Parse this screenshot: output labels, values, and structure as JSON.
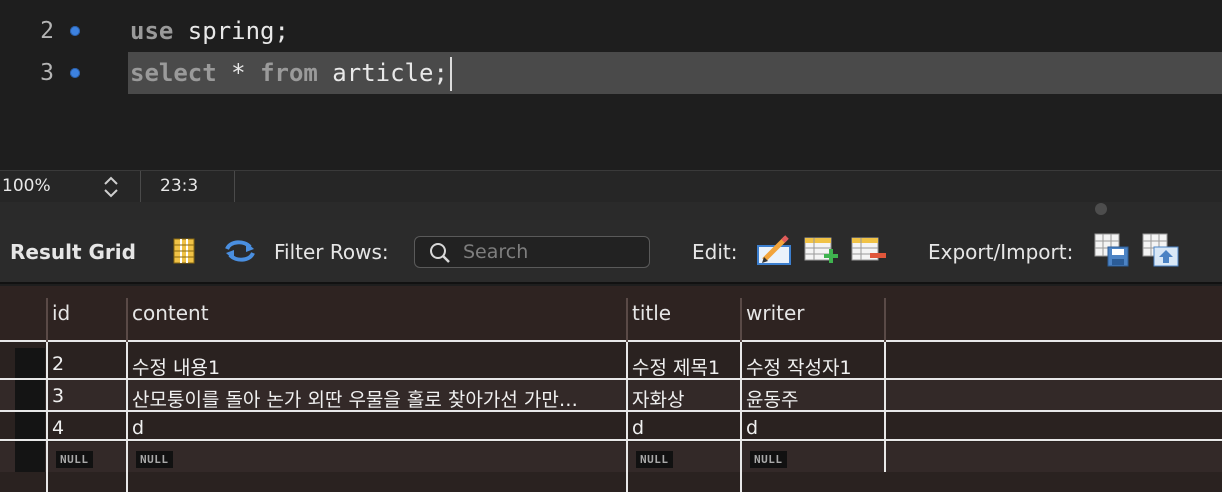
{
  "editor": {
    "lines": [
      {
        "number": "2",
        "keyword": "use",
        "rest": " spring;"
      },
      {
        "number": "3",
        "keyword": "select",
        "op": " * ",
        "keyword2": "from",
        "rest": " article;"
      }
    ]
  },
  "statusbar": {
    "zoom": "100%",
    "cursor": "23:3"
  },
  "toolbar": {
    "title": "Result Grid",
    "filter_label": "Filter Rows:",
    "search_placeholder": "Search",
    "edit_label": "Edit:",
    "export_label": "Export/Import:"
  },
  "grid": {
    "columns": [
      "id",
      "content",
      "title",
      "writer"
    ],
    "rows": [
      {
        "id": "2",
        "content": "수정 내용1",
        "title": "수정 제목1",
        "writer": "수정 작성자1"
      },
      {
        "id": "3",
        "content": "산모퉁이를 돌아 논가 외딴 우물을 홀로 찾아가선 가만…",
        "title": "자화상",
        "writer": "윤동주"
      },
      {
        "id": "4",
        "content": "d",
        "title": "d",
        "writer": "d"
      }
    ],
    "null_label": "NULL"
  },
  "colors": {
    "accent_blue": "#3d82e0",
    "editor_bg": "#1e1e1e",
    "grid_bg": "#2a2220",
    "highlight": "#4a4a4a"
  }
}
